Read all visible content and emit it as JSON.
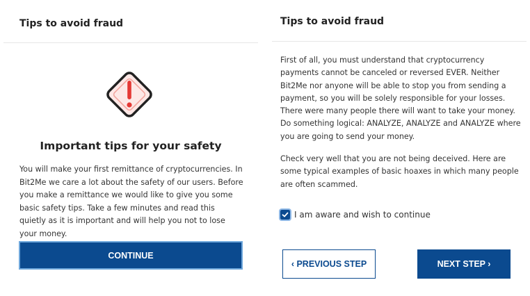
{
  "left_panel": {
    "title": "Tips to avoid fraud",
    "icon": "warning-diamond-icon",
    "heading": "Important tips for your safety",
    "intro": "You will make your first remittance of cryptocurrencies. In Bit2Me we care a lot about the safety of our users. Before you make a remittance we would like to give you some basic safety tips. Take a few minutes and read this quietly as it is important and will help you not to lose your money.",
    "continue_label": "CONTINUE"
  },
  "right_panel": {
    "title": "Tips to avoid fraud",
    "paragraph1": "First of all, you must understand that cryptocurrency payments cannot be canceled or reversed EVER. Neither Bit2Me nor anyone will be able to stop you from sending a payment, so you will be solely responsible for your losses. There were many people there will want to take your money. Do something logical: ANALYZE, ANALYZE and ANALYZE where you are going to send your money.",
    "paragraph2": "Check very well that you are not being deceived. Here are some typical examples of basic hoaxes in which many people are often scammed.",
    "checkbox_label": "I am aware and wish to continue",
    "checkbox_checked": true,
    "prev_label": "‹ PREVIOUS STEP",
    "next_label": "NEXT STEP ›"
  },
  "colors": {
    "primary": "#0b4a8f",
    "warning_red": "#e53935",
    "warning_fill": "#fde8e6"
  }
}
